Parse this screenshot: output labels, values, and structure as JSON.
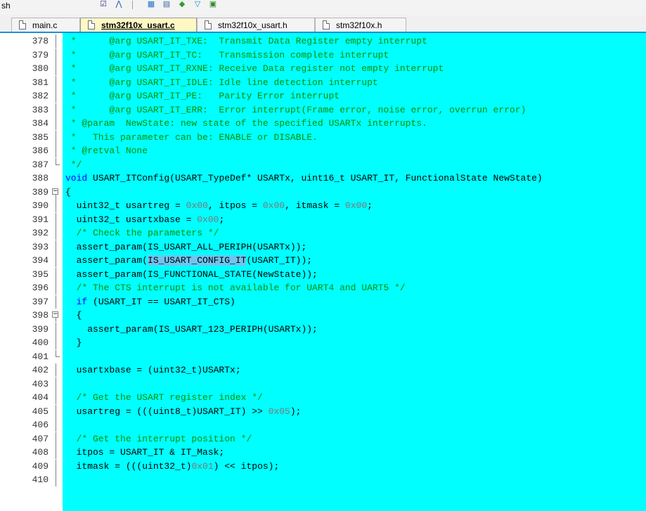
{
  "toolbar": {
    "label": "sh",
    "icons": [
      "checkbox-icon",
      "branch-icon",
      "window-icon",
      "layers-icon",
      "diamond-icon",
      "filter-icon",
      "image-icon"
    ],
    "icon_glyphs": [
      "☑",
      "⋀",
      "▦",
      "▤",
      "◆",
      "▽",
      "▣"
    ],
    "icon_colors": [
      "#3a3a8a",
      "#1a56b0",
      "#1e6fc9",
      "#3a6aa0",
      "#2ea02e",
      "#1a8ac9",
      "#2e8a2e"
    ]
  },
  "tabs": [
    {
      "label": "main.c",
      "active": false
    },
    {
      "label": "stm32f10x_usart.c",
      "active": true
    },
    {
      "label": "stm32f10x_usart.h",
      "active": false
    },
    {
      "label": "stm32f10x.h",
      "active": false
    }
  ],
  "editor": {
    "background": "#00ffff",
    "lines": [
      {
        "n": "378",
        "fold": "line",
        "segs": [
          {
            "t": " *      @arg USART_IT_TXE:  Transmit Data Register empty interrupt",
            "c": "cm"
          }
        ]
      },
      {
        "n": "379",
        "fold": "line",
        "segs": [
          {
            "t": " *      @arg USART_IT_TC:   Transmission complete interrupt",
            "c": "cm"
          }
        ]
      },
      {
        "n": "380",
        "fold": "line",
        "segs": [
          {
            "t": " *      @arg USART_IT_RXNE: Receive Data register not empty interrupt",
            "c": "cm"
          }
        ]
      },
      {
        "n": "381",
        "fold": "line",
        "segs": [
          {
            "t": " *      @arg USART_IT_IDLE: Idle line detection interrupt",
            "c": "cm"
          }
        ]
      },
      {
        "n": "382",
        "fold": "line",
        "segs": [
          {
            "t": " *      @arg USART_IT_PE:   Parity Error interrupt",
            "c": "cm"
          }
        ]
      },
      {
        "n": "383",
        "fold": "line",
        "segs": [
          {
            "t": " *      @arg USART_IT_ERR:  Error interrupt(Frame error, noise error, overrun error)",
            "c": "cm"
          }
        ]
      },
      {
        "n": "384",
        "fold": "line",
        "segs": [
          {
            "t": " * @param  NewState: new state of the specified USARTx interrupts.",
            "c": "cm"
          }
        ]
      },
      {
        "n": "385",
        "fold": "line",
        "segs": [
          {
            "t": " *   This parameter can be: ENABLE or DISABLE.",
            "c": "cm"
          }
        ]
      },
      {
        "n": "386",
        "fold": "line",
        "segs": [
          {
            "t": " * @retval None",
            "c": "cm"
          }
        ]
      },
      {
        "n": "387",
        "fold": "end",
        "segs": [
          {
            "t": " */",
            "c": "cm"
          }
        ]
      },
      {
        "n": "388",
        "fold": "none",
        "segs": [
          {
            "t": "void",
            "c": "kw"
          },
          {
            "t": " USART_ITConfig(USART_TypeDef* USARTx, uint16_t USART_IT, FunctionalState NewState)",
            "c": ""
          }
        ]
      },
      {
        "n": "389",
        "fold": "box",
        "segs": [
          {
            "t": "{",
            "c": ""
          }
        ]
      },
      {
        "n": "390",
        "fold": "line",
        "segs": [
          {
            "t": "  uint32_t usartreg = ",
            "c": ""
          },
          {
            "t": "0x00",
            "c": "num"
          },
          {
            "t": ", itpos = ",
            "c": ""
          },
          {
            "t": "0x00",
            "c": "num"
          },
          {
            "t": ", itmask = ",
            "c": ""
          },
          {
            "t": "0x00",
            "c": "num"
          },
          {
            "t": ";",
            "c": ""
          }
        ]
      },
      {
        "n": "391",
        "fold": "line",
        "segs": [
          {
            "t": "  uint32_t usartxbase = ",
            "c": ""
          },
          {
            "t": "0x00",
            "c": "num"
          },
          {
            "t": ";",
            "c": ""
          }
        ]
      },
      {
        "n": "392",
        "fold": "line",
        "segs": [
          {
            "t": "  /* Check the parameters */",
            "c": "cm"
          }
        ]
      },
      {
        "n": "393",
        "fold": "line",
        "segs": [
          {
            "t": "  assert_param(IS_USART_ALL_PERIPH(USARTx));",
            "c": ""
          }
        ]
      },
      {
        "n": "394",
        "fold": "line",
        "segs": [
          {
            "t": "  assert_param(",
            "c": ""
          },
          {
            "t": "IS_USART_CONFIG_IT",
            "c": "hl"
          },
          {
            "t": "(USART_IT));",
            "c": ""
          }
        ]
      },
      {
        "n": "395",
        "fold": "line",
        "segs": [
          {
            "t": "  assert_param(IS_FUNCTIONAL_STATE(NewState));",
            "c": ""
          }
        ]
      },
      {
        "n": "396",
        "fold": "line",
        "segs": [
          {
            "t": "  /* The CTS interrupt is not available for UART4 and UART5 */",
            "c": "cm"
          }
        ]
      },
      {
        "n": "397",
        "fold": "line",
        "segs": [
          {
            "t": "  ",
            "c": ""
          },
          {
            "t": "if",
            "c": "kw"
          },
          {
            "t": " (USART_IT == USART_IT_CTS)",
            "c": ""
          }
        ]
      },
      {
        "n": "398",
        "fold": "box",
        "segs": [
          {
            "t": "  {",
            "c": ""
          }
        ]
      },
      {
        "n": "399",
        "fold": "line",
        "segs": [
          {
            "t": "    assert_param(IS_USART_123_PERIPH(USARTx));",
            "c": ""
          }
        ]
      },
      {
        "n": "400",
        "fold": "line",
        "segs": [
          {
            "t": "  }",
            "c": ""
          }
        ]
      },
      {
        "n": "401",
        "fold": "end",
        "segs": [
          {
            "t": "",
            "c": ""
          }
        ]
      },
      {
        "n": "402",
        "fold": "line",
        "segs": [
          {
            "t": "  usartxbase = (uint32_t)USARTx;",
            "c": ""
          }
        ]
      },
      {
        "n": "403",
        "fold": "line",
        "segs": [
          {
            "t": "",
            "c": ""
          }
        ]
      },
      {
        "n": "404",
        "fold": "line",
        "segs": [
          {
            "t": "  /* Get the USART register index */",
            "c": "cm"
          }
        ]
      },
      {
        "n": "405",
        "fold": "line",
        "segs": [
          {
            "t": "  usartreg = (((uint8_t)USART_IT) >> ",
            "c": ""
          },
          {
            "t": "0x05",
            "c": "num"
          },
          {
            "t": ");",
            "c": ""
          }
        ]
      },
      {
        "n": "406",
        "fold": "line",
        "segs": [
          {
            "t": "",
            "c": ""
          }
        ]
      },
      {
        "n": "407",
        "fold": "line",
        "segs": [
          {
            "t": "  /* Get the interrupt position */",
            "c": "cm"
          }
        ]
      },
      {
        "n": "408",
        "fold": "line",
        "segs": [
          {
            "t": "  itpos = USART_IT & IT_Mask;",
            "c": ""
          }
        ]
      },
      {
        "n": "409",
        "fold": "line",
        "segs": [
          {
            "t": "  itmask = (((uint32_t)",
            "c": ""
          },
          {
            "t": "0x01",
            "c": "num"
          },
          {
            "t": ") << itpos);",
            "c": ""
          }
        ]
      },
      {
        "n": "410",
        "fold": "line",
        "segs": [
          {
            "t": "",
            "c": ""
          }
        ]
      }
    ]
  }
}
